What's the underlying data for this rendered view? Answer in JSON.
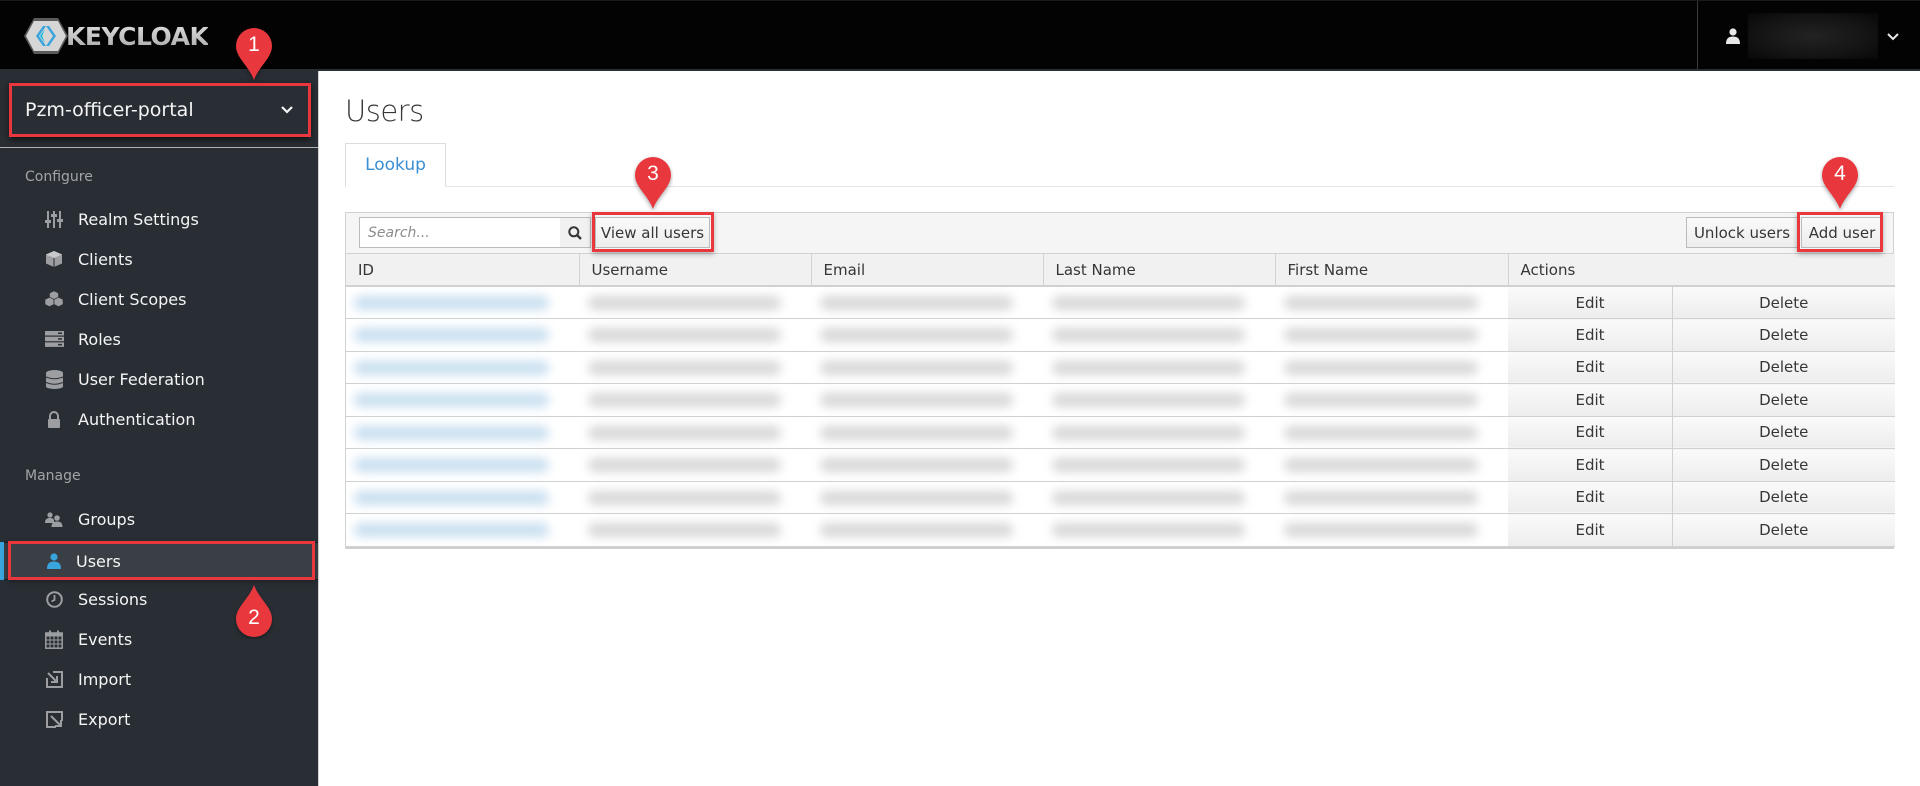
{
  "header": {
    "logo_text": "KEYCLOAK",
    "user_name": "",
    "user_icon": "user-icon",
    "caret_icon": "chevron-down-icon"
  },
  "sidebar": {
    "realm": "Pzm-officer-portal",
    "configure_label": "Configure",
    "configure_items": [
      {
        "label": "Realm Settings",
        "icon": "sliders-icon"
      },
      {
        "label": "Clients",
        "icon": "cube-icon"
      },
      {
        "label": "Client Scopes",
        "icon": "cubes-icon"
      },
      {
        "label": "Roles",
        "icon": "server-icon"
      },
      {
        "label": "User Federation",
        "icon": "database-icon"
      },
      {
        "label": "Authentication",
        "icon": "lock-icon"
      }
    ],
    "manage_label": "Manage",
    "manage_items": [
      {
        "label": "Groups",
        "icon": "users-icon"
      },
      {
        "label": "Users",
        "icon": "user-icon",
        "active": true
      },
      {
        "label": "Sessions",
        "icon": "clock-icon"
      },
      {
        "label": "Events",
        "icon": "calendar-icon"
      },
      {
        "label": "Import",
        "icon": "import-icon"
      },
      {
        "label": "Export",
        "icon": "export-icon"
      }
    ]
  },
  "main": {
    "title": "Users",
    "tabs": [
      {
        "label": "Lookup",
        "active": true
      }
    ],
    "toolbar": {
      "search_placeholder": "Search...",
      "search_value": "",
      "view_all_label": "View all users",
      "unlock_label": "Unlock users",
      "add_label": "Add user"
    },
    "table": {
      "columns": [
        "ID",
        "Username",
        "Email",
        "Last Name",
        "First Name",
        "Actions"
      ],
      "rows_note": "cell values redacted (blurred)",
      "row_count": 8,
      "edit_label": "Edit",
      "delete_label": "Delete"
    }
  },
  "annotations": [
    {
      "number": "1",
      "target": "realm-select"
    },
    {
      "number": "2",
      "target": "sidebar-item-users"
    },
    {
      "number": "3",
      "target": "view-all-users-button"
    },
    {
      "number": "4",
      "target": "add-user-button"
    }
  ],
  "colors": {
    "header_bg": "#030303",
    "sidebar_bg": "#292e34",
    "active_accent": "#39a5dc",
    "link_blue": "#3a8ed4",
    "annotation_red": "#e8383d"
  }
}
